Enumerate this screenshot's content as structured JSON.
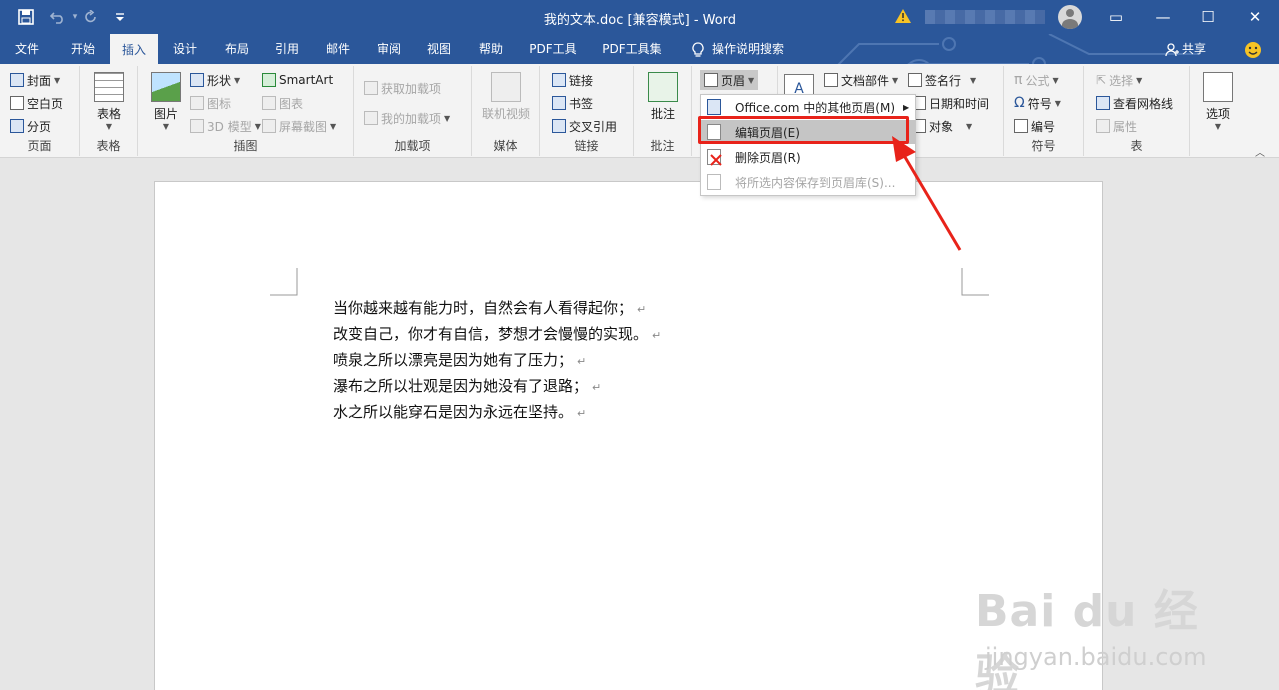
{
  "window": {
    "title": "我的文本.doc [兼容模式] - Word",
    "accent": "#2b579a"
  },
  "quick_access": {
    "save_icon": "save-icon",
    "undo_icon": "undo-icon",
    "redo_icon": "redo-icon",
    "customize_icon": "chevron-down-icon"
  },
  "window_controls": {
    "ribbon_display": "▭",
    "minimize": "—",
    "maximize": "☐",
    "close": "✕"
  },
  "tabs": [
    {
      "label": "文件"
    },
    {
      "label": "开始"
    },
    {
      "label": "插入"
    },
    {
      "label": "设计"
    },
    {
      "label": "布局"
    },
    {
      "label": "引用"
    },
    {
      "label": "邮件"
    },
    {
      "label": "审阅"
    },
    {
      "label": "视图"
    },
    {
      "label": "帮助"
    },
    {
      "label": "PDF工具"
    },
    {
      "label": "PDF工具集"
    },
    {
      "label": "操作说明搜索"
    }
  ],
  "share_label": "共享",
  "ribbon": {
    "pages": {
      "label": "页面",
      "cover": "封面",
      "blank": "空白页",
      "break": "分页"
    },
    "tables": {
      "label": "表格",
      "table": "表格"
    },
    "illustrations": {
      "label": "插图",
      "picture": "图片",
      "shapes": "形状",
      "icons": "图标",
      "model3d": "3D 模型",
      "smartart": "SmartArt",
      "chart": "图表",
      "screenshot": "屏幕截图"
    },
    "addins": {
      "label": "加载项",
      "get": "获取加载项",
      "my": "我的加载项"
    },
    "media": {
      "label": "媒体",
      "video": "联机视频"
    },
    "links": {
      "label": "链接",
      "link": "链接",
      "bookmark": "书签",
      "crossref": "交叉引用"
    },
    "comments": {
      "label": "批注",
      "comment": "批注"
    },
    "header_footer": {
      "header": "页眉"
    },
    "text": {
      "docparts": "文档部件",
      "signature": "签名行",
      "datetime": "日期和时间",
      "object": "对象"
    },
    "symbols": {
      "label": "符号",
      "equation": "公式",
      "symbol": "符号",
      "number": "编号"
    },
    "table2": {
      "label": "表",
      "select": "选择",
      "gridlines": "查看网格线",
      "properties": "属性"
    },
    "options": {
      "label": "选项"
    }
  },
  "header_menu": {
    "items": [
      {
        "label": "Office.com 中的其他页眉(M)",
        "enabled": true
      },
      {
        "label": "编辑页眉(E)",
        "enabled": true,
        "highlighted": true
      },
      {
        "label": "删除页眉(R)",
        "enabled": true
      },
      {
        "label": "将所选内容保存到页眉库(S)...",
        "enabled": false
      }
    ]
  },
  "document": {
    "lines": [
      "当你越来越有能力时，自然会有人看得起你；",
      "改变自己，你才有自信，梦想才会慢慢的实现。",
      "喷泉之所以漂亮是因为她有了压力；",
      "瀑布之所以壮观是因为她没有了退路；",
      "水之所以能穿石是因为永远在坚持。"
    ],
    "paragraph_mark": "↵"
  },
  "watermark": {
    "logo": "Bai du 经验",
    "url": "jingyan.baidu.com"
  },
  "annotation": {
    "box_color": "#e8231a"
  }
}
